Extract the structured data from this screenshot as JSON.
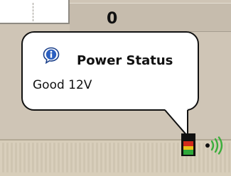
{
  "background_window": {
    "stat_value": "0"
  },
  "tooltip": {
    "icon": "info-icon",
    "title": "Power Status",
    "message": "Good 12V"
  },
  "tray": {
    "icons": [
      "power-status-icon",
      "wireless-signal-icon"
    ]
  },
  "colors": {
    "power_red": "#d22a1c",
    "power_yellow": "#e8c21a",
    "power_green": "#2fa83a",
    "wireless_green": "#3cae3c"
  }
}
